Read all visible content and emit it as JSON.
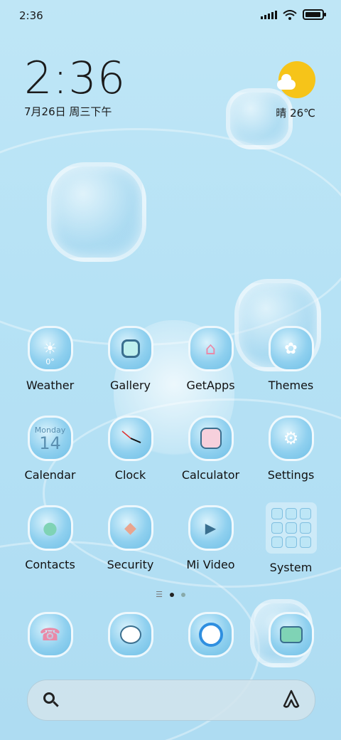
{
  "status_bar": {
    "time": "2:36"
  },
  "clock_widget": {
    "time": "2:36",
    "date": "7月26日 周三下午"
  },
  "weather_widget": {
    "condition_temp": "晴 26℃",
    "icon": "sun-cloud-icon"
  },
  "apps": [
    {
      "label": "Weather",
      "icon": "weather-icon"
    },
    {
      "label": "Gallery",
      "icon": "gallery-icon"
    },
    {
      "label": "GetApps",
      "icon": "store-icon"
    },
    {
      "label": "Themes",
      "icon": "themes-icon"
    },
    {
      "label": "Calendar",
      "icon": "calendar-icon",
      "icon_text": "Monday",
      "icon_num": "14"
    },
    {
      "label": "Clock",
      "icon": "clock-icon"
    },
    {
      "label": "Calculator",
      "icon": "calculator-icon"
    },
    {
      "label": "Settings",
      "icon": "settings-icon"
    },
    {
      "label": "Contacts",
      "icon": "contacts-icon"
    },
    {
      "label": "Security",
      "icon": "security-icon"
    },
    {
      "label": "Mi Video",
      "icon": "video-icon"
    },
    {
      "label": "System",
      "icon": "folder-icon"
    }
  ],
  "weather_icon_text": "0°",
  "page_indicator": {
    "current": 1,
    "total": 2
  },
  "dock": [
    {
      "icon": "phone-icon"
    },
    {
      "icon": "messages-icon"
    },
    {
      "icon": "browser-icon"
    },
    {
      "icon": "camera-icon"
    }
  ],
  "colors": {
    "accent_sun": "#f6c419",
    "icon_blue": "#8fd0ef"
  }
}
